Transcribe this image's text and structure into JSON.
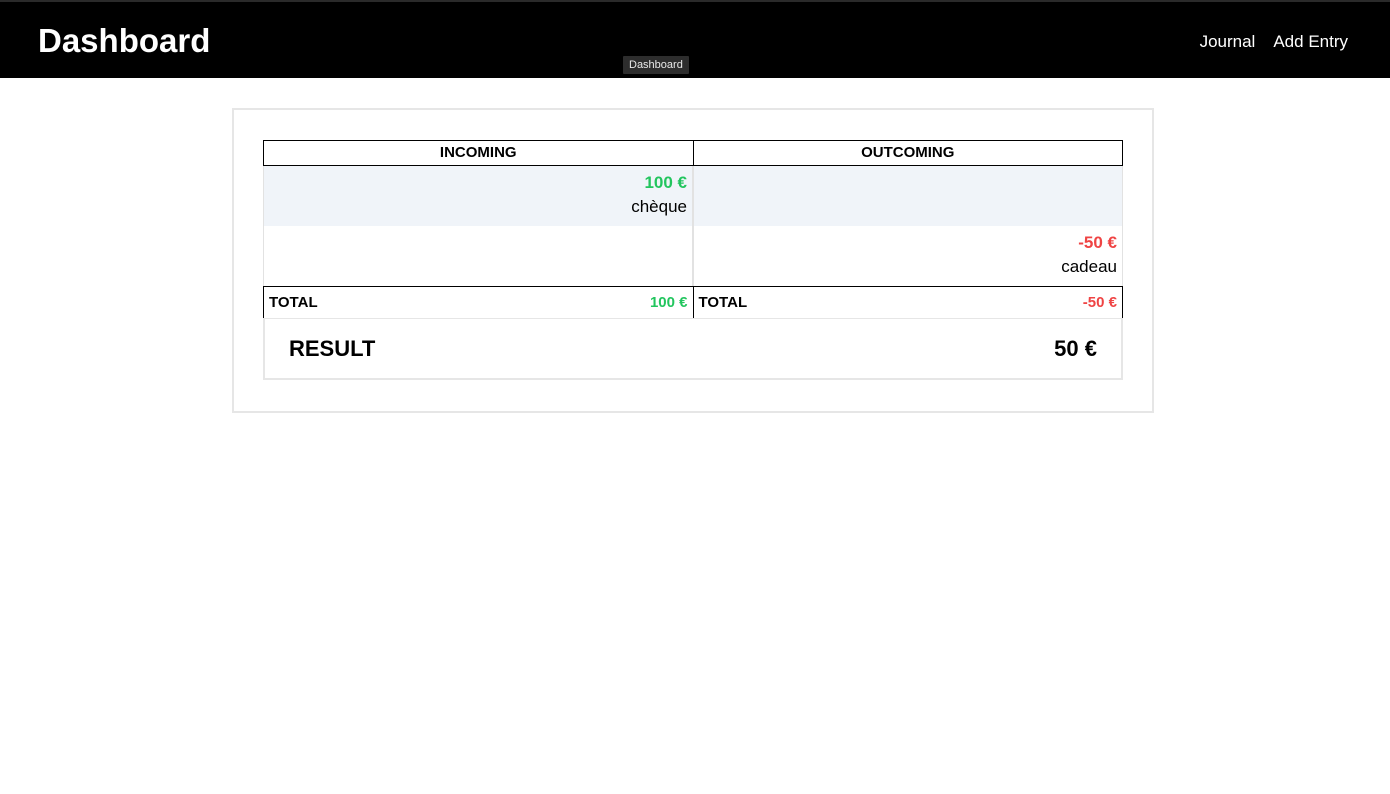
{
  "header": {
    "title": "Dashboard",
    "tooltip": "Dashboard",
    "nav": [
      {
        "label": "Journal"
      },
      {
        "label": "Add Entry"
      }
    ]
  },
  "ledger": {
    "columns": [
      "INCOMING",
      "OUTCOMING"
    ],
    "rows": [
      {
        "incoming_amount": "100 €",
        "incoming_label": "chèque",
        "outcoming_amount": "",
        "outcoming_label": ""
      },
      {
        "incoming_amount": "",
        "incoming_label": "",
        "outcoming_amount": "-50 €",
        "outcoming_label": "cadeau"
      }
    ],
    "totals": {
      "incoming_label": "TOTAL",
      "incoming_value": "100 €",
      "outcoming_label": "TOTAL",
      "outcoming_value": "-50 €"
    },
    "result": {
      "label": "RESULT",
      "value": "50 €"
    }
  },
  "colors": {
    "positive": "#22c55e",
    "negative": "#ef4444",
    "topbar": "#000000",
    "row_shade": "#f0f4f9"
  }
}
